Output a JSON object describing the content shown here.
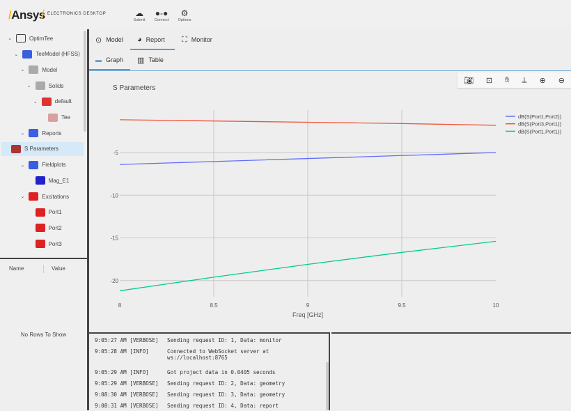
{
  "header": {
    "brand": "Ansys",
    "product": "ELECTRONICS DESKTOP",
    "buttons": [
      {
        "label": "Submit",
        "icon": "cloud-icon"
      },
      {
        "label": "Connect",
        "icon": "connect-icon"
      },
      {
        "label": "Options",
        "icon": "gear-icon"
      }
    ]
  },
  "tree": [
    {
      "label": "OptimTee",
      "level": 0,
      "expanded": true,
      "icon": "folder-icon"
    },
    {
      "label": "TeeModel (HFSS)",
      "level": 1,
      "expanded": true,
      "icon": "hfss-icon"
    },
    {
      "label": "Model",
      "level": 2,
      "expanded": true,
      "icon": "model-icon"
    },
    {
      "label": "Solids",
      "level": 3,
      "expanded": true,
      "icon": "solids-icon"
    },
    {
      "label": "default",
      "level": 4,
      "expanded": true,
      "icon": "material-icon"
    },
    {
      "label": "Tee",
      "level": 5,
      "icon": "solid-box-icon"
    },
    {
      "label": "Reports",
      "level": 2,
      "expanded": true,
      "icon": "reports-icon"
    },
    {
      "label": "S Parameters",
      "level": 3,
      "icon": "report-plot-icon",
      "selected": true
    },
    {
      "label": "Fieldplots",
      "level": 2,
      "expanded": true,
      "icon": "fieldplots-icon"
    },
    {
      "label": "Mag_E1",
      "level": 3,
      "icon": "field-plot-icon"
    },
    {
      "label": "Excitations",
      "level": 2,
      "expanded": true,
      "icon": "excitations-icon"
    },
    {
      "label": "Port1",
      "level": 3,
      "icon": "port-icon"
    },
    {
      "label": "Port2",
      "level": 3,
      "icon": "port-icon"
    },
    {
      "label": "Port3",
      "level": 3,
      "icon": "port-icon"
    }
  ],
  "properties": {
    "columns": [
      "Name",
      "Value"
    ],
    "empty": "No Rows To Show"
  },
  "tabs": [
    {
      "label": "Model",
      "icon": "model-view-icon"
    },
    {
      "label": "Report",
      "icon": "pie-chart-icon",
      "active": true
    },
    {
      "label": "Monitor",
      "icon": "fullscreen-icon"
    }
  ],
  "subtabs": [
    {
      "label": "Graph",
      "icon": "graph-icon",
      "active": true
    },
    {
      "label": "Table",
      "icon": "table-icon"
    }
  ],
  "toolbar": [
    "camera-icon",
    "autoscale-icon",
    "pan-hand-icon",
    "axes-reset-icon",
    "zoom-in-icon",
    "zoom-out-icon"
  ],
  "chart_data": {
    "type": "line",
    "title": "S Parameters",
    "xlabel": "Freq [GHz]",
    "ylabel": "",
    "xlim": [
      8,
      10
    ],
    "ylim": [
      -22.5,
      1
    ],
    "xticks": [
      8,
      8.5,
      9,
      9.5,
      10
    ],
    "yticks": [
      -5,
      -10,
      -15,
      -20
    ],
    "grid": true,
    "legend": "top-right",
    "x": [
      8,
      8.5,
      9,
      9.5,
      10
    ],
    "series": [
      {
        "name": "dB(S(Port1,Port2))",
        "color": "#636efa",
        "values": [
          -6.4,
          -6.05,
          -5.7,
          -5.35,
          -5.0
        ]
      },
      {
        "name": "dB(S(Port3,Port1))",
        "color": "#ef553b",
        "values": [
          -1.15,
          -1.3,
          -1.45,
          -1.6,
          -1.8
        ]
      },
      {
        "name": "dB(S(Port1,Port1))",
        "color": "#00cc96",
        "values": [
          -21.2,
          -19.6,
          -18.1,
          -16.7,
          -15.4
        ]
      }
    ]
  },
  "log": [
    {
      "time": "9:05:27 AM [VERBOSE]",
      "msg": "Sending request ID: 1, Data: monitor"
    },
    {
      "time": "9:05:28 AM [INFO]",
      "msg": "Connected to WebSocket server at ws://localhost:8765"
    },
    {
      "time": "9:05:29 AM [INFO]",
      "msg": "Got project data in 0.0405 seconds"
    },
    {
      "time": "9:05:29 AM [VERBOSE]",
      "msg": "Sending request ID: 2, Data: geometry"
    },
    {
      "time": "9:08:30 AM [VERBOSE]",
      "msg": "Sending request ID: 3, Data: geometry"
    },
    {
      "time": "9:08:31 AM [VERBOSE]",
      "msg": "Sending request ID: 4, Data: report"
    }
  ]
}
